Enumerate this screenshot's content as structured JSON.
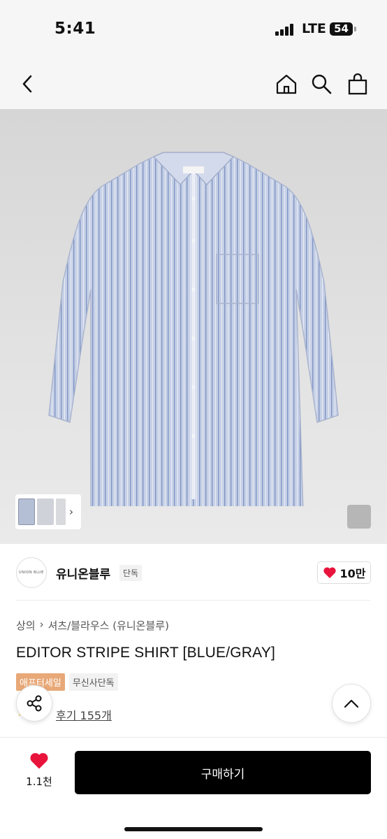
{
  "status": {
    "time": "5:41",
    "network": "LTE",
    "battery": "54"
  },
  "nav": {
    "back_icon": "chevron-left-icon",
    "home_icon": "home-icon",
    "search_icon": "search-icon",
    "bag_icon": "shopping-bag-icon"
  },
  "gallery": {
    "thumb_next": "›"
  },
  "brand": {
    "logo_text": "UNION BLUE",
    "name": "유니온블루",
    "tag": "단독",
    "likes": "10만",
    "heart_color": "#e8143c"
  },
  "breadcrumb": {
    "category": "상의",
    "separator": "›",
    "subcategory": "셔츠/블라우스 (유니온블루)"
  },
  "product": {
    "title": "EDITOR STRIPE SHIRT [BLUE/GRAY]",
    "badges": {
      "sale": "애프터세일",
      "exclusive": "무신사단독"
    },
    "review": "후기 155개"
  },
  "bottom": {
    "wish_count": "1.1천",
    "buy_label": "구매하기"
  },
  "colors": {
    "accent": "#e8a877",
    "buy_bg": "#000000",
    "shirt": "#c3cde3"
  }
}
